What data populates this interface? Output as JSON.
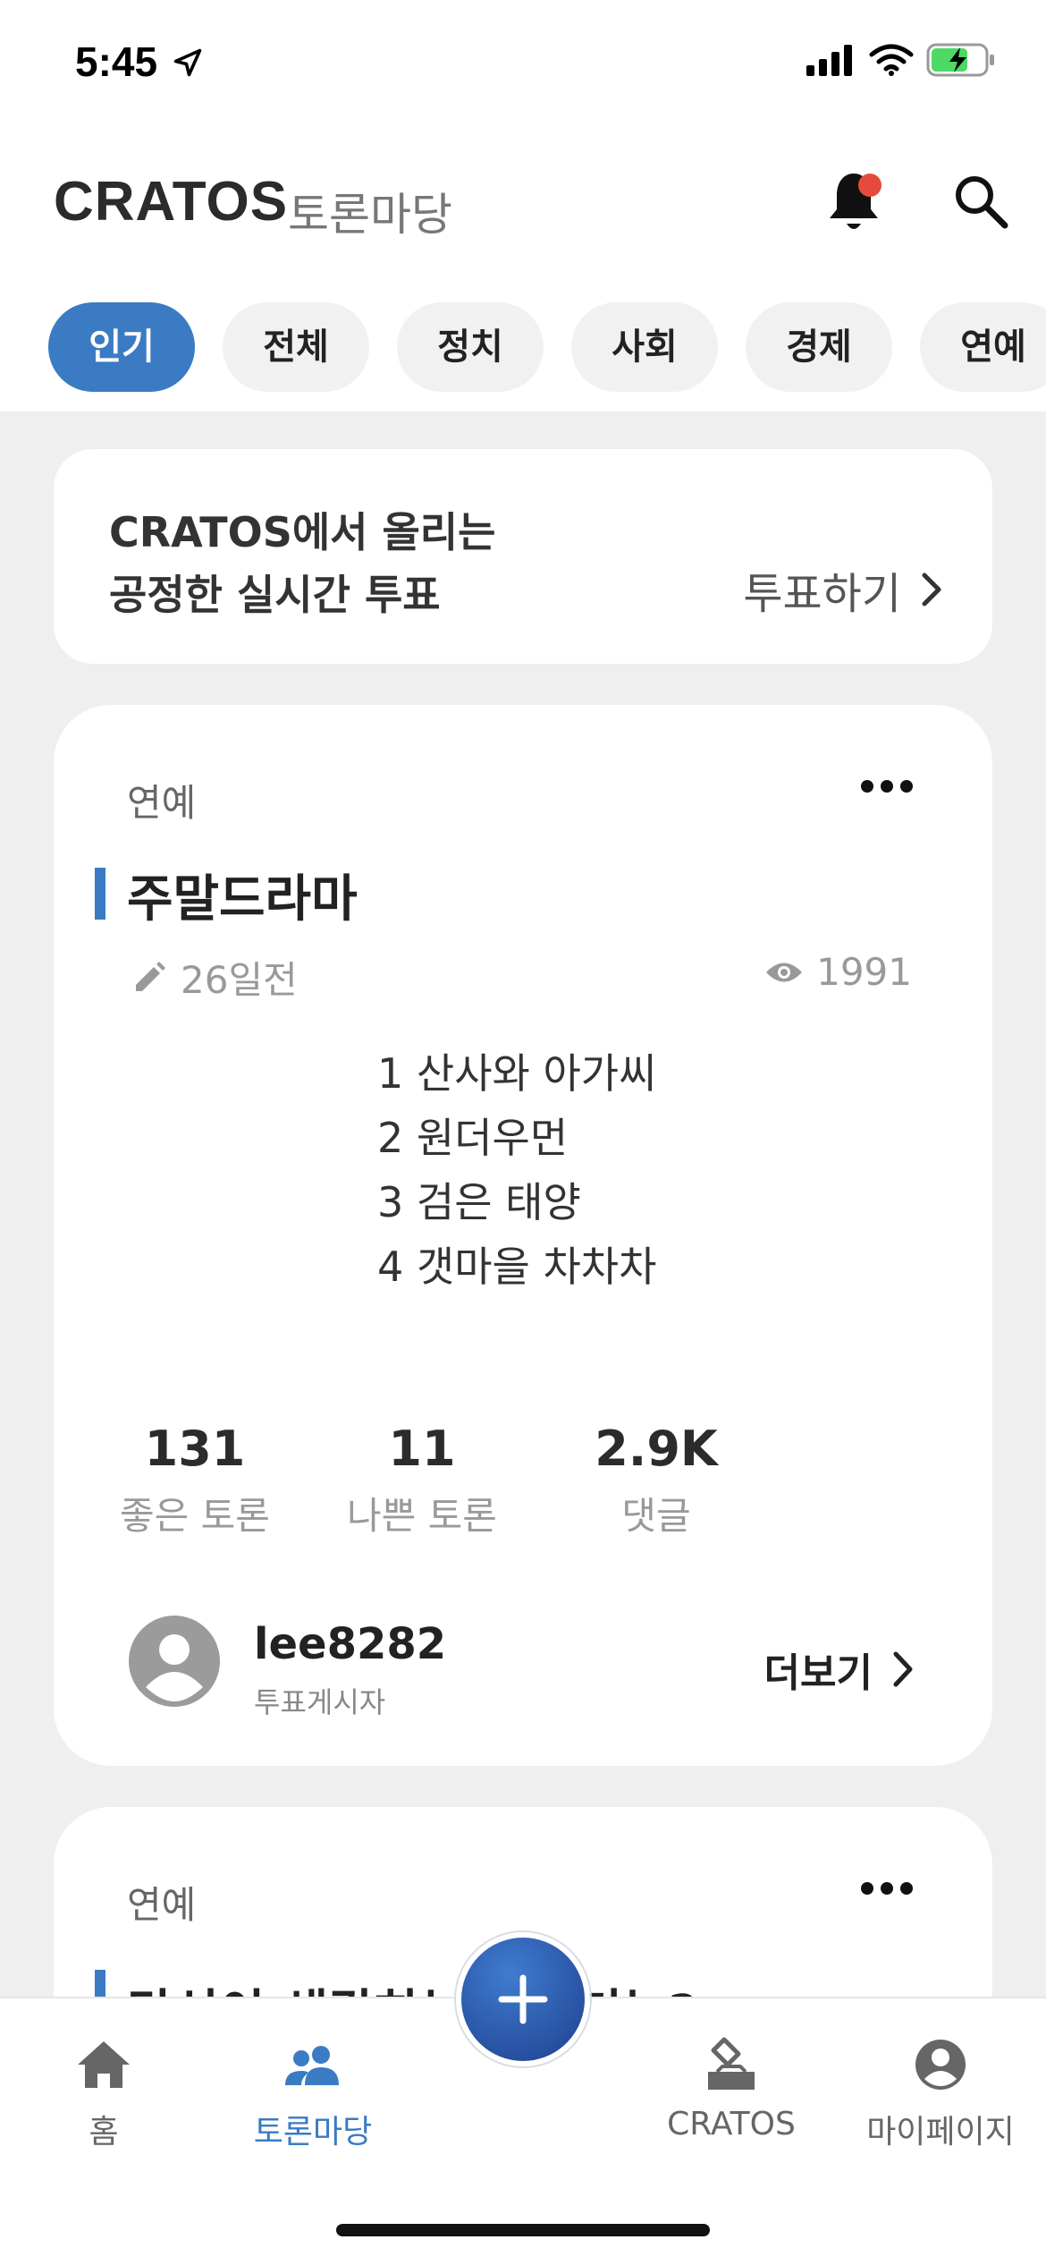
{
  "status_bar": {
    "time": "5:45"
  },
  "header": {
    "brand": "CRATOS",
    "subtitle": "토론마당",
    "notification_dot_color": "#e64a3c"
  },
  "tabs": [
    {
      "label": "인기",
      "active": true
    },
    {
      "label": "전체",
      "active": false
    },
    {
      "label": "정치",
      "active": false
    },
    {
      "label": "사회",
      "active": false
    },
    {
      "label": "경제",
      "active": false
    },
    {
      "label": "연예",
      "active": false
    }
  ],
  "vote_banner": {
    "line1": "CRATOS에서 올리는",
    "line2": "공정한 실시간 투표",
    "cta": "투표하기"
  },
  "posts": [
    {
      "category": "연예",
      "title": "주말드라마",
      "time": "26일전",
      "views": "1991",
      "content": [
        "1 산사와 아가씨",
        "2 원더우먼",
        "3 검은 태양",
        "4 갯마을 차차차"
      ],
      "good_count": "131",
      "good_label": "좋은 토론",
      "bad_count": "11",
      "bad_label": "나쁜 토론",
      "comment_count": "2.9K",
      "comment_label": "댓글",
      "author": "lee8282",
      "author_role": "투표게시자",
      "more": "더보기"
    },
    {
      "category": "연예",
      "title": "당신이 생각하는 전력기는?"
    }
  ],
  "bottom_nav": {
    "items": [
      {
        "label": "홈",
        "icon": "home-icon"
      },
      {
        "label": "토론마당",
        "icon": "people-icon",
        "active": true
      },
      {
        "label": "CRATOS",
        "icon": "vote-box-icon"
      },
      {
        "label": "마이페이지",
        "icon": "user-circle-icon"
      }
    ]
  },
  "colors": {
    "accent": "#3a7bc4",
    "background": "#efefef"
  }
}
